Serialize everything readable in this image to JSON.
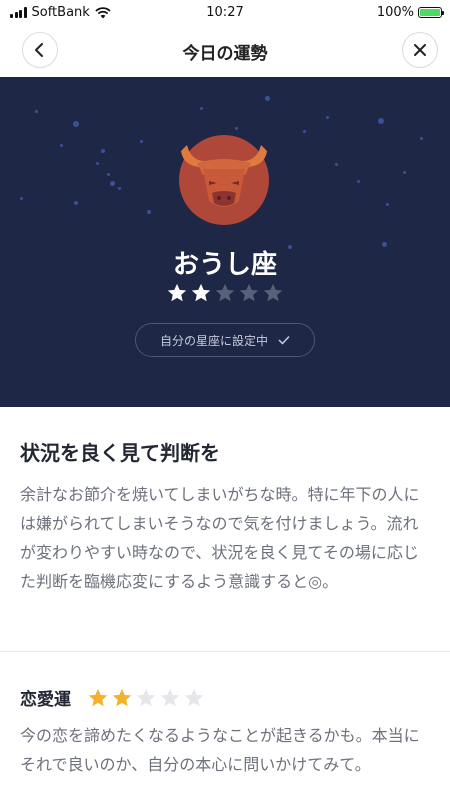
{
  "status_bar": {
    "carrier": "SoftBank",
    "time": "10:27",
    "battery": "100%",
    "battery_level": 1.0
  },
  "nav": {
    "title": "今日の運勢",
    "back_icon": "chevron-left-icon",
    "close_icon": "close-icon"
  },
  "hero": {
    "sign_name": "おうし座",
    "sign_icon": "taurus-bull-icon",
    "overall_rating": 2,
    "max_rating": 5,
    "setting_label": "自分の星座に設定中",
    "colors": {
      "background": "#1e2745",
      "star_filled": "#ffffff",
      "star_empty": "#596079",
      "emblem": "#b0483a"
    }
  },
  "fortune": {
    "headline": "状況を良く見て判断を",
    "body": "余計なお節介を焼いてしまいがちな時。特に年下の人には嫌がられてしまいそうなので気を付けましょう。流れが変わりやすい時なので、状況を良く見てその場に応じた判断を臨機応変にするよう意識すると◎。"
  },
  "love": {
    "title": "恋愛運",
    "rating": 2,
    "max_rating": 5,
    "text": "今の恋を諦めたくなるようなことが起きるかも。本当にそれで良いのか、自分の本心に問いかけてみて。",
    "colors": {
      "star_filled": "#f3b12c",
      "star_empty": "#e6e7ea"
    }
  }
}
